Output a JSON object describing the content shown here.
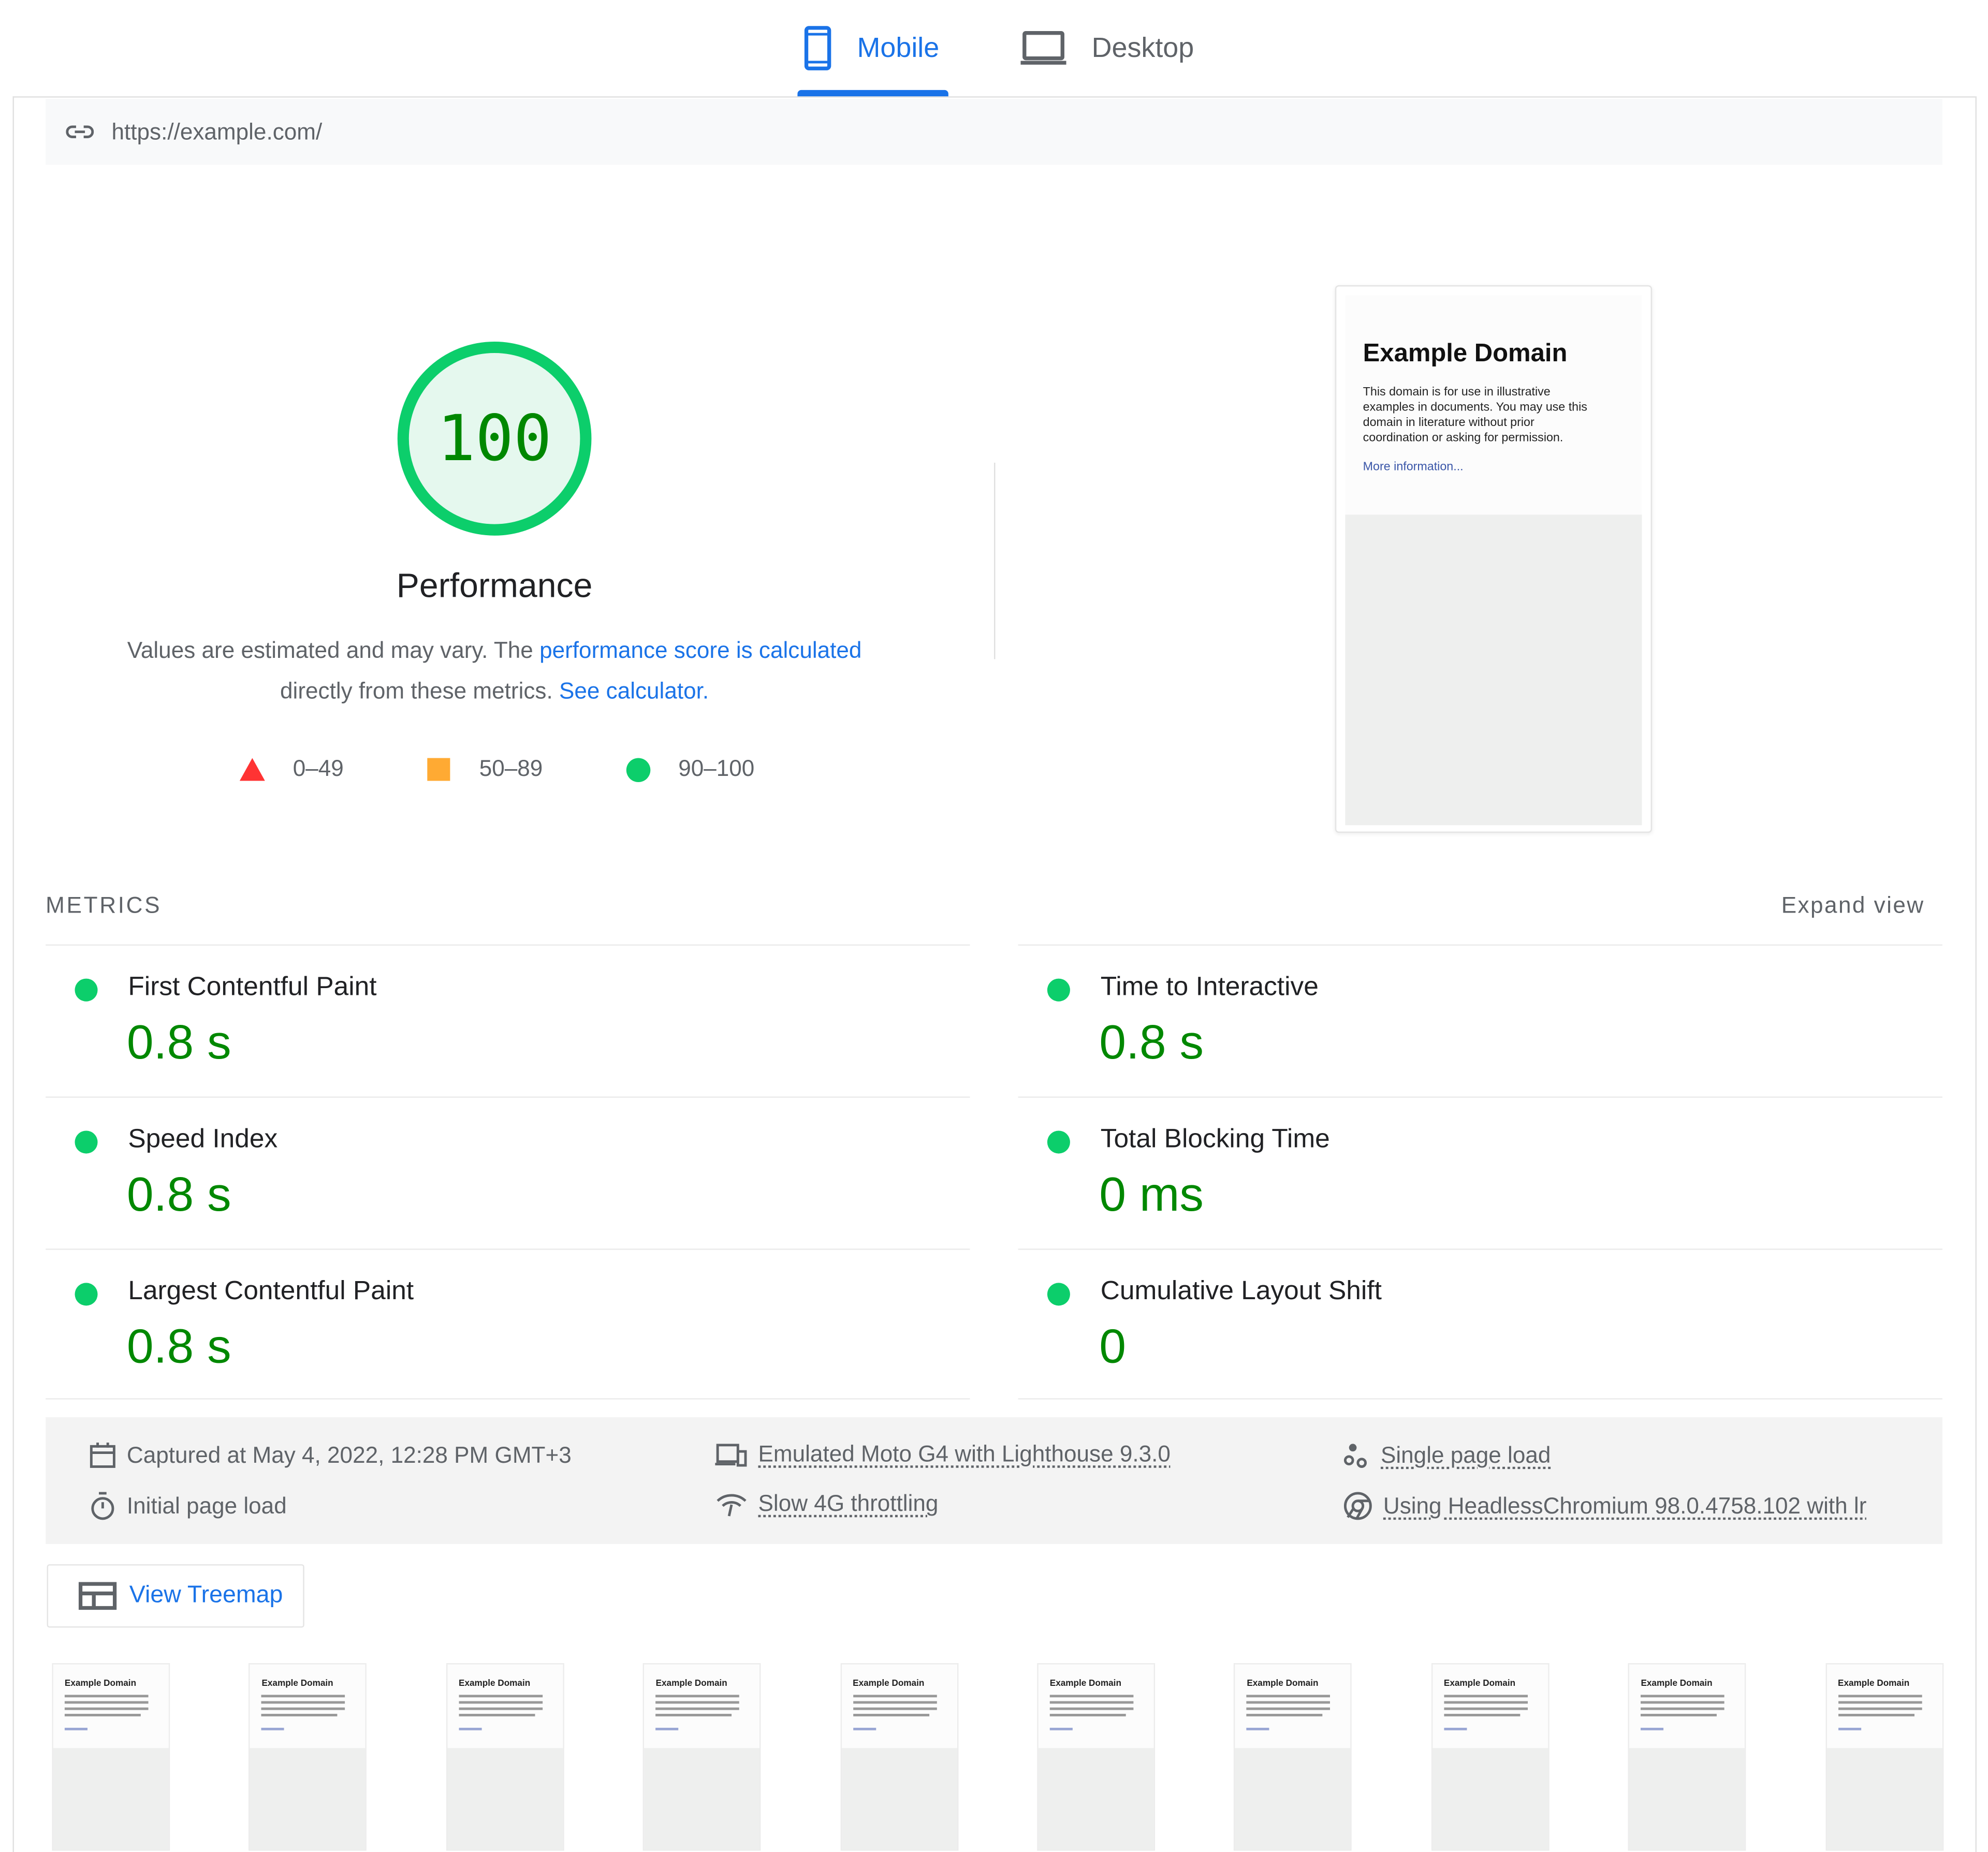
{
  "tabs": [
    {
      "label": "Mobile",
      "icon": "phone-icon",
      "active": true
    },
    {
      "label": "Desktop",
      "icon": "laptop-icon",
      "active": false
    }
  ],
  "url": "https://example.com/",
  "score": {
    "value": "100",
    "label": "Performance",
    "fraction": 1.0,
    "color": "#0cce6b"
  },
  "description": {
    "text1": "Values are estimated and may vary. The ",
    "link1": "performance score is calculated",
    "text2": "directly from these metrics. ",
    "link2": "See calculator."
  },
  "legend": [
    {
      "range": "0–49",
      "color": "#ff3333"
    },
    {
      "range": "50–89",
      "color": "#ffaa33"
    },
    {
      "range": "90–100",
      "color": "#0cce6b"
    }
  ],
  "screenshot": {
    "title": "Example Domain",
    "body": "This domain is for use in illustrative examples in documents. You may use this domain in literature without prior coordination or asking for permission.",
    "link": "More information..."
  },
  "metrics_section": {
    "title": "METRICS",
    "expand": "Expand view"
  },
  "metrics": [
    {
      "label": "First Contentful Paint",
      "value": "0.8 s"
    },
    {
      "label": "Time to Interactive",
      "value": "0.8 s"
    },
    {
      "label": "Speed Index",
      "value": "0.8 s"
    },
    {
      "label": "Total Blocking Time",
      "value": "0 ms"
    },
    {
      "label": "Largest Contentful Paint",
      "value": "0.8 s"
    },
    {
      "label": "Cumulative Layout Shift",
      "value": "0"
    }
  ],
  "info": {
    "captured": "Captured at May 4, 2022, 12:28 PM GMT+3",
    "initial": "Initial page load",
    "device": "Emulated Moto G4 with Lighthouse 9.3.0",
    "throttling": "Slow 4G throttling",
    "single": "Single page load",
    "browser": "Using HeadlessChromium 98.0.4758.102 with lr"
  },
  "treemap_button": "View Treemap",
  "filmstrip_title": "Example Domain"
}
